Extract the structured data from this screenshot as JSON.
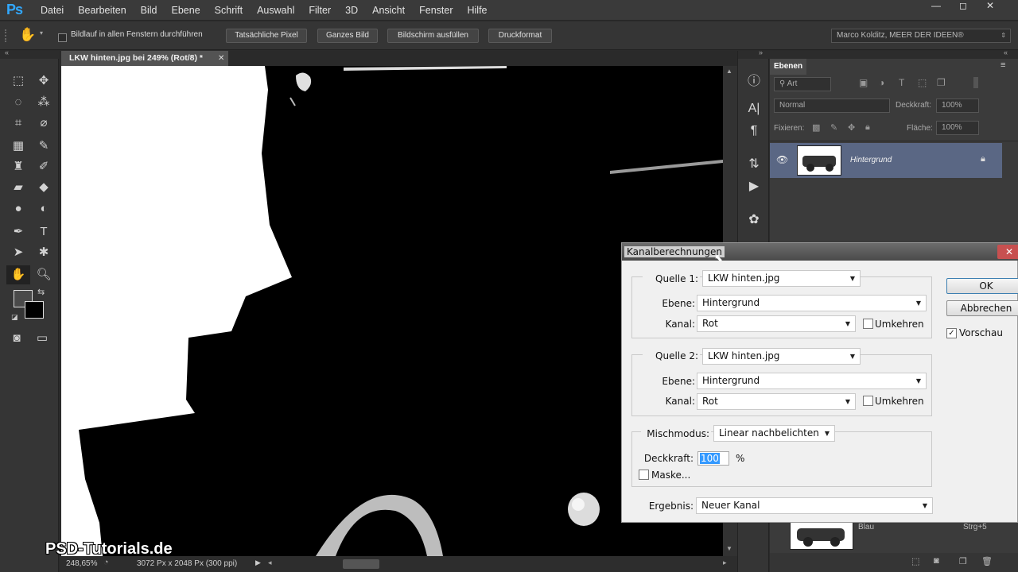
{
  "app": {
    "logo": "Ps"
  },
  "menu": [
    "Datei",
    "Bearbeiten",
    "Bild",
    "Ebene",
    "Schrift",
    "Auswahl",
    "Filter",
    "3D",
    "Ansicht",
    "Fenster",
    "Hilfe"
  ],
  "window_controls": {
    "minimize": "—",
    "restore": "◻",
    "close": "✕"
  },
  "options": {
    "scroll_all_label": "Bildlauf in allen Fenstern durchführen",
    "buttons": [
      "Tatsächliche Pixel",
      "Ganzes Bild",
      "Bildschirm ausfüllen",
      "Druckformat"
    ],
    "workspace": "Marco Kolditz, MEER DER IDEEN®"
  },
  "document": {
    "tab_title": "LKW hinten.jpg bei 249% (Rot/8) *",
    "zoom": "248,65%",
    "doc_info": "3072 Px x 2048 Px (300 ppi)"
  },
  "layers_panel": {
    "tab": "Ebenen",
    "filter_kind": "Art",
    "blend_mode": "Normal",
    "opacity_label": "Deckkraft:",
    "opacity_value": "100%",
    "lock_label": "Fixieren:",
    "fill_label": "Fläche:",
    "fill_value": "100%",
    "layer_name": "Hintergrund",
    "channel_name": "Blau",
    "channel_shortcut": "Strg+5"
  },
  "dialog": {
    "title": "Kanalberechnungen",
    "source1": {
      "label": "Quelle 1:",
      "file": "LKW hinten.jpg",
      "layer_label": "Ebene:",
      "layer": "Hintergrund",
      "channel_label": "Kanal:",
      "channel": "Rot",
      "invert_label": "Umkehren",
      "invert": false
    },
    "source2": {
      "label": "Quelle 2:",
      "file": "LKW hinten.jpg",
      "layer_label": "Ebene:",
      "layer": "Hintergrund",
      "channel_label": "Kanal:",
      "channel": "Rot",
      "invert_label": "Umkehren",
      "invert": false
    },
    "blend_label": "Mischmodus:",
    "blend_mode": "Linear nachbelichten",
    "opacity_label": "Deckkraft:",
    "opacity_value": "100",
    "opacity_unit": "%",
    "mask_label": "Maske...",
    "result_label": "Ergebnis:",
    "result": "Neuer Kanal",
    "ok_label": "OK",
    "cancel_label": "Abbrechen",
    "preview_label": "Vorschau",
    "preview": true
  },
  "watermark": "PSD-Tutorials.de"
}
